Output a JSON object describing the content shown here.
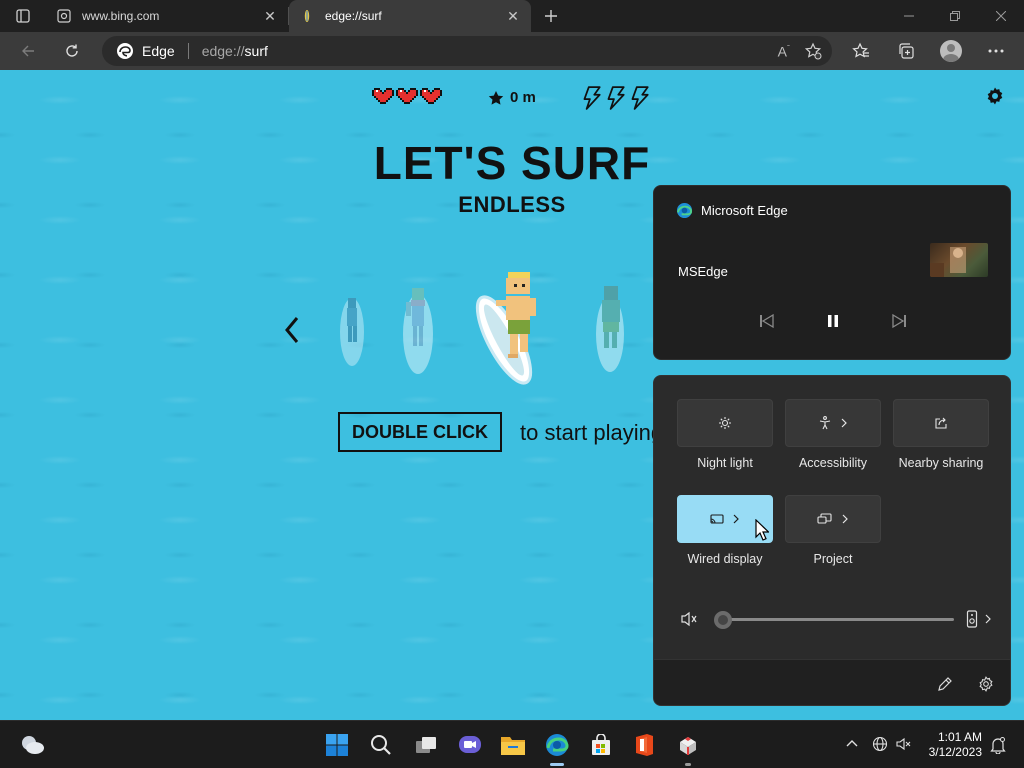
{
  "browser": {
    "tabs": [
      {
        "title": "www.bing.com",
        "active": false
      },
      {
        "title": "edge://surf",
        "active": true
      }
    ],
    "address": {
      "brand_label": "Edge",
      "url_scheme": "edge://",
      "url_host": "surf"
    }
  },
  "game": {
    "distance": "0 m",
    "lives": 3,
    "boosts": 3,
    "title": "LET'S SURF",
    "mode": "ENDLESS",
    "cta_button": "DOUBLE CLICK",
    "cta_tail": "to start playing"
  },
  "media": {
    "app_name": "Microsoft Edge",
    "track": "MSEdge",
    "state": "playing"
  },
  "quick_settings": {
    "tiles": [
      {
        "label": "Night light",
        "icon": "brightness-icon",
        "chevron": false,
        "active": false
      },
      {
        "label": "Accessibility",
        "icon": "accessibility-icon",
        "chevron": true,
        "active": false
      },
      {
        "label": "Nearby sharing",
        "icon": "share-icon",
        "chevron": false,
        "active": false
      },
      {
        "label": "Wired display",
        "icon": "cast-icon",
        "chevron": true,
        "active": true
      },
      {
        "label": "Project",
        "icon": "project-icon",
        "chevron": true,
        "active": false
      }
    ],
    "volume": 0,
    "muted": true
  },
  "taskbar": {
    "apps": [
      "start",
      "search",
      "task-view",
      "teams-chat",
      "file-explorer",
      "edge",
      "microsoft-store",
      "office",
      "app"
    ],
    "time": "1:01 AM",
    "date": "3/12/2023"
  },
  "colors": {
    "ocean": "#3dbfe0",
    "accent_tile": "#98dcf5",
    "flyout_bg": "#2b2b2b"
  }
}
